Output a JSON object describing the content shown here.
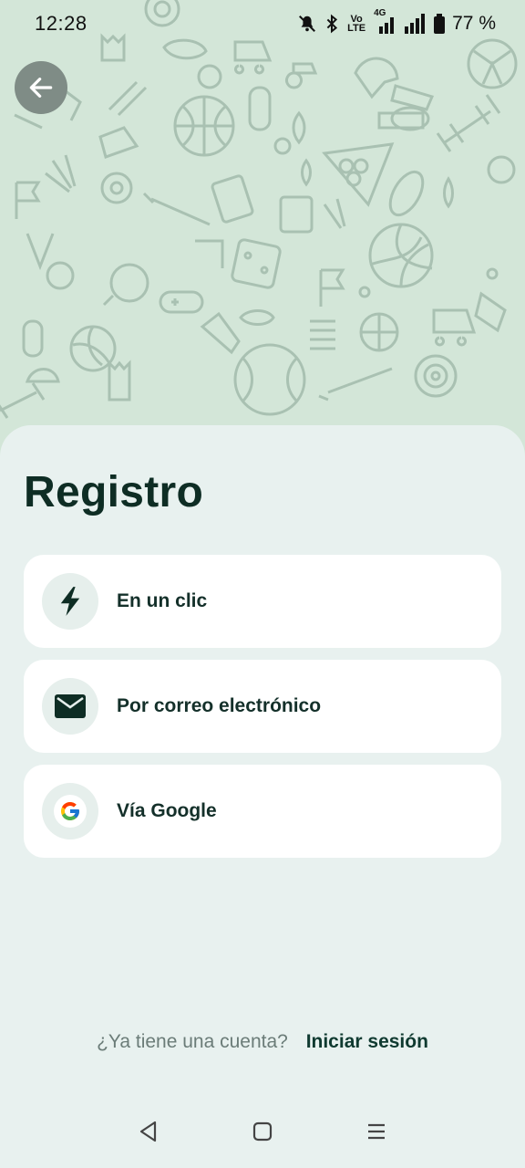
{
  "status_bar": {
    "time": "12:28",
    "battery": "77 %",
    "volte": "Vo LTE",
    "network": "4G",
    "icons": [
      "mute-bell-icon",
      "bluetooth-icon",
      "volte-icon",
      "signal-4g-icon",
      "signal-icon",
      "battery-icon"
    ]
  },
  "header": {
    "back_icon": "arrow-left-icon"
  },
  "main": {
    "title": "Registro",
    "options": [
      {
        "label": "En un clic",
        "icon": "lightning-icon"
      },
      {
        "label": "Por correo electrónico",
        "icon": "envelope-icon"
      },
      {
        "label": "Vía Google",
        "icon": "google-icon"
      }
    ]
  },
  "footer": {
    "question": "¿Ya tiene una cuenta?",
    "login_link": "Iniciar sesión"
  },
  "nav": {
    "icons": [
      "back-triangle-icon",
      "home-square-icon",
      "menu-lines-icon"
    ]
  },
  "colors": {
    "hero_bg": "#d3e6d8",
    "sheet_bg": "#e8f1ef",
    "accent": "#0e2d24",
    "back_button": "#7f8c86"
  }
}
